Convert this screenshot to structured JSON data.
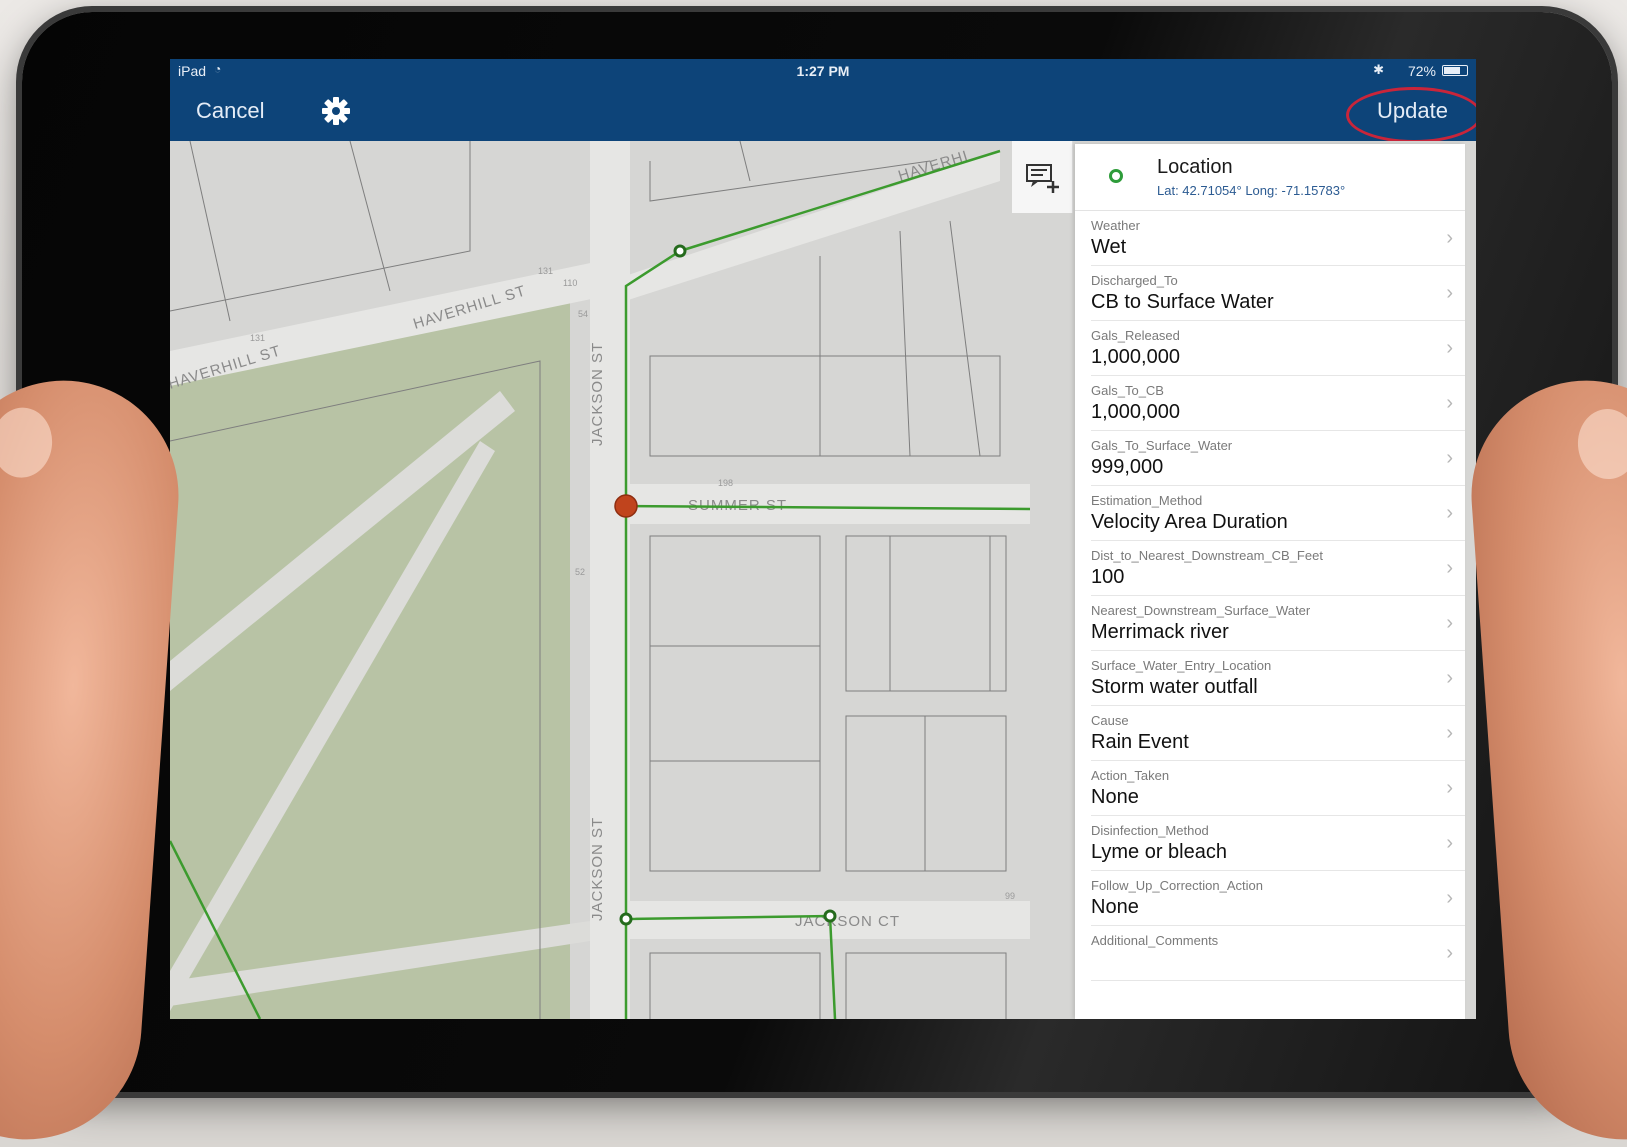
{
  "status_bar": {
    "device": "iPad",
    "time": "1:27 PM",
    "battery": "72%",
    "battery_level": 0.72
  },
  "nav": {
    "cancel_label": "Cancel",
    "update_label": "Update",
    "settings_icon": "gear-icon"
  },
  "map": {
    "streets": [
      "HAVERHILL ST",
      "HAVERHILL ST",
      "JACKSON ST",
      "JACKSON ST",
      "SUMMER ST",
      "JACKSON CT",
      "HAVERHI"
    ],
    "parcel_numbers": [
      "131",
      "110",
      "131",
      "54",
      "198",
      "52",
      "99"
    ],
    "colors": {
      "base": "#d6d6d4",
      "park": "#b6c2a4",
      "line": "#3c9b2e",
      "selected_point": "#c0441d"
    }
  },
  "panel": {
    "add_note_icon": "add-note-icon",
    "location": {
      "title": "Location",
      "coords": "Lat: 42.71054° Long: -71.15783°"
    },
    "fields": [
      {
        "label": "Weather",
        "value": "Wet"
      },
      {
        "label": "Discharged_To",
        "value": "CB to Surface Water"
      },
      {
        "label": "Gals_Released",
        "value": "1,000,000"
      },
      {
        "label": "Gals_To_CB",
        "value": "1,000,000"
      },
      {
        "label": "Gals_To_Surface_Water",
        "value": "999,000"
      },
      {
        "label": "Estimation_Method",
        "value": "Velocity Area Duration"
      },
      {
        "label": "Dist_to_Nearest_Downstream_CB_Feet",
        "value": "100"
      },
      {
        "label": "Nearest_Downstream_Surface_Water",
        "value": "Merrimack river"
      },
      {
        "label": "Surface_Water_Entry_Location",
        "value": "Storm water outfall"
      },
      {
        "label": "Cause",
        "value": "Rain Event"
      },
      {
        "label": "Action_Taken",
        "value": "None"
      },
      {
        "label": "Disinfection_Method",
        "value": "Lyme or bleach"
      },
      {
        "label": "Follow_Up_Correction_Action",
        "value": "None"
      },
      {
        "label": "Additional_Comments",
        "value": ""
      }
    ],
    "chevron": "›"
  }
}
